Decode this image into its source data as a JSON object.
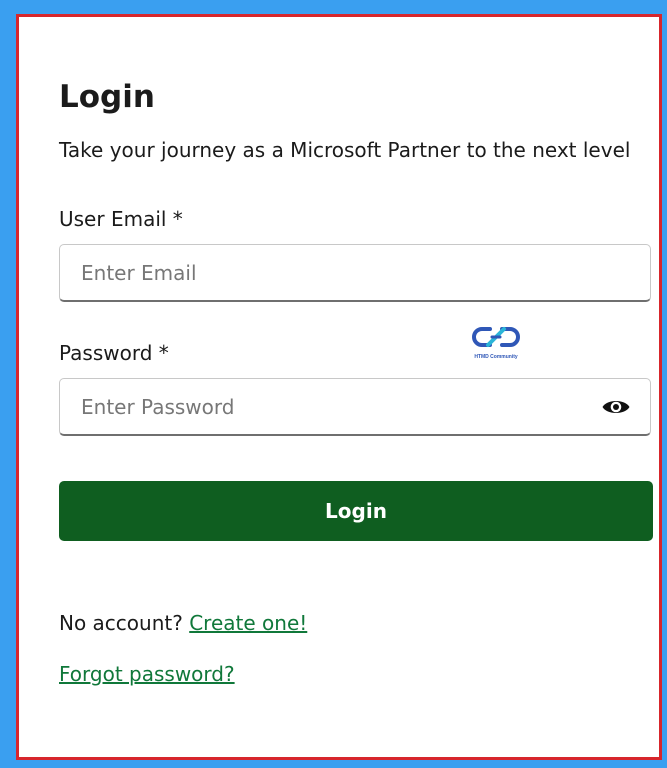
{
  "login_form": {
    "title": "Login",
    "subtitle": "Take your journey as a Microsoft Partner to the next level",
    "email_label": "User Email *",
    "email_placeholder": "Enter Email",
    "email_value": "",
    "password_label": "Password *",
    "password_placeholder": "Enter Password",
    "password_value": "",
    "password_toggle_icon": "eye-icon",
    "login_button_label": "Login",
    "no_account_text": "No account?",
    "create_account_link": "Create one!",
    "forgot_password_link": "Forgot password?"
  },
  "watermark": {
    "text": "HTMD Community"
  },
  "colors": {
    "outer_background": "#3a9ff0",
    "frame_border": "#d7262c",
    "button_background": "#0f5e20",
    "link_color": "#10783a"
  }
}
